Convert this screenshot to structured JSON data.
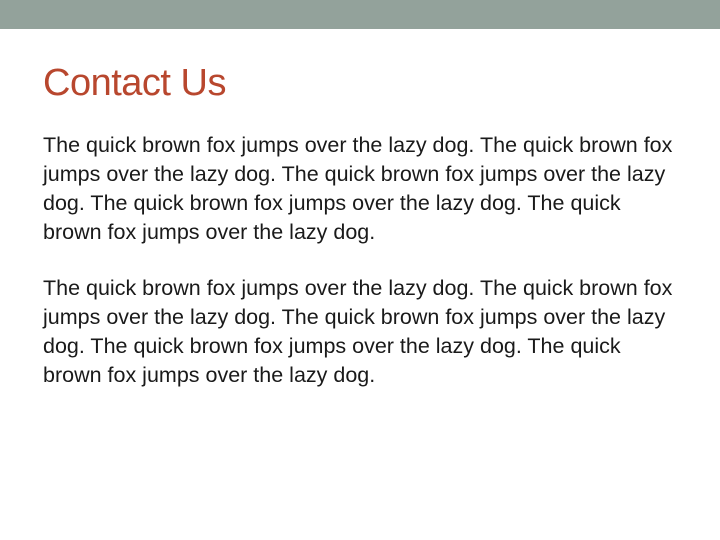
{
  "colors": {
    "top_bar": "#93a29b",
    "title": "#b8472e",
    "body_text": "#1a1a1a"
  },
  "slide": {
    "title": "Contact Us",
    "paragraphs": [
      "The quick brown fox jumps over the lazy dog. The quick brown fox jumps over the lazy dog. The quick brown fox jumps over the lazy dog. The quick brown fox jumps over the lazy dog. The quick brown fox jumps over the lazy dog.",
      "The quick brown fox jumps over the lazy dog. The quick brown fox jumps over the lazy dog. The quick brown fox jumps over the lazy dog. The quick brown fox jumps over the lazy dog. The quick brown fox jumps over the lazy dog."
    ]
  }
}
